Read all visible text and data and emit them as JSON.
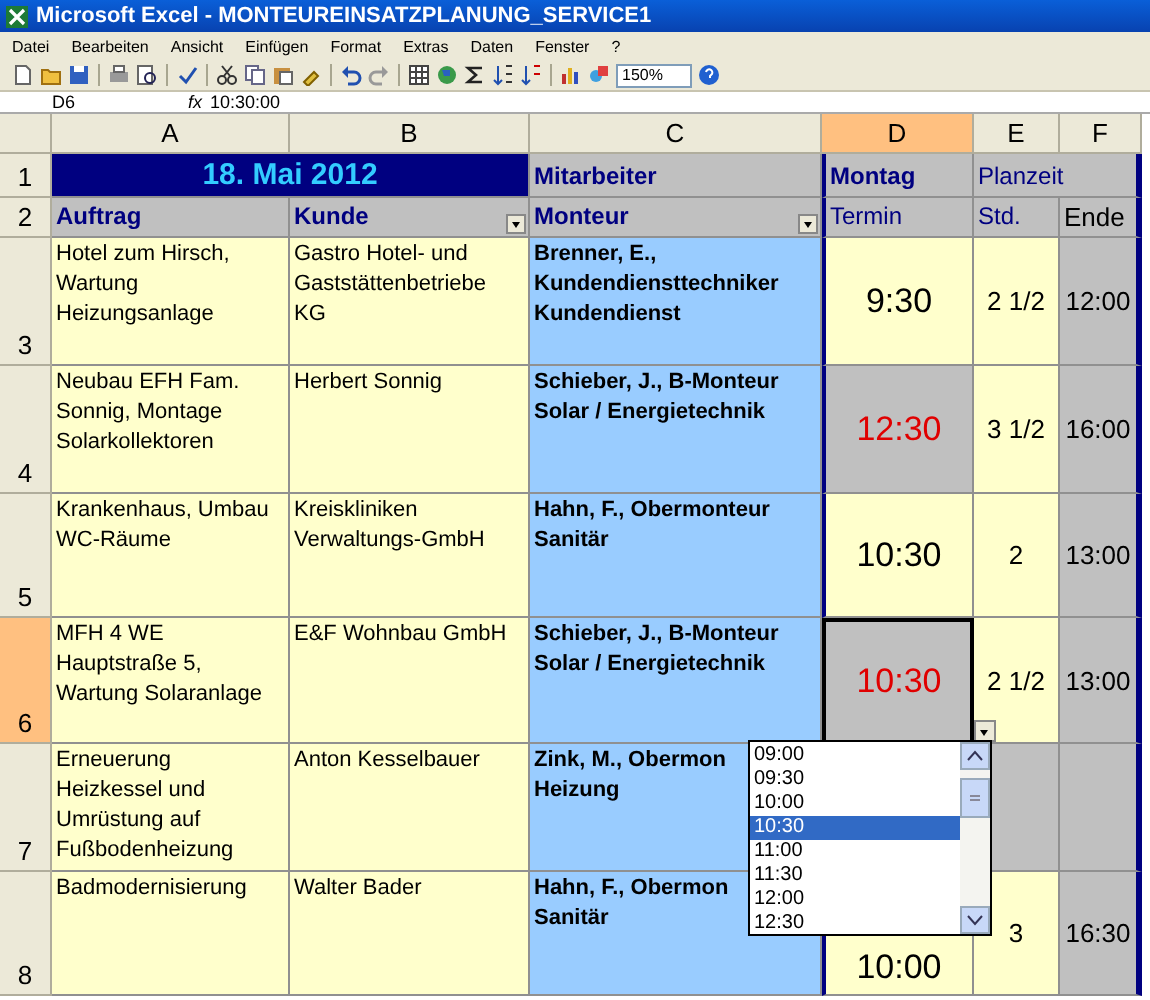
{
  "window": {
    "title": "Microsoft Excel - MONTEUREINSATZPLANUNG_SERVICE1"
  },
  "menu": [
    "Datei",
    "Bearbeiten",
    "Ansicht",
    "Einfügen",
    "Format",
    "Extras",
    "Daten",
    "Fenster",
    "?"
  ],
  "toolbar": {
    "zoom": "150%"
  },
  "formula_bar": {
    "name_box": "D6",
    "fx_label": "fx",
    "formula": "10:30:00"
  },
  "columns": [
    {
      "label": "A",
      "selected": false
    },
    {
      "label": "B",
      "selected": false
    },
    {
      "label": "C",
      "selected": false
    },
    {
      "label": "D",
      "selected": true
    },
    {
      "label": "E",
      "selected": false
    },
    {
      "label": "F",
      "selected": false
    }
  ],
  "title_row": {
    "number": "1",
    "date": "18. Mai 2012",
    "group": "Mitarbeiter",
    "day": "Montag",
    "planned": "Planzeit"
  },
  "heading_row": {
    "number": "2",
    "cells": [
      {
        "text": "Auftrag",
        "filter": false
      },
      {
        "text": "Kunde",
        "filter": true
      },
      {
        "text": "Monteur",
        "filter": true
      },
      {
        "text": "Termin",
        "filter": false
      },
      {
        "text": "Std.",
        "filter": false
      },
      {
        "text": "Ende",
        "filter": false
      }
    ]
  },
  "rows": [
    {
      "number": "3",
      "selected": false,
      "order": "Hotel zum Hirsch,\nWartung\nHeizungsanlage",
      "customer": "Gastro Hotel- und\nGaststättenbetriebe\nKG",
      "fitter": "Brenner, E.,\nKundendiensttechniker\nKundendienst",
      "time": "9:30",
      "conflict": false,
      "blocked": false,
      "hours": "2 1/2",
      "end": "12:00"
    },
    {
      "number": "4",
      "selected": false,
      "order": "Neubau EFH Fam.\nSonnig, Montage\nSolarkollektoren",
      "customer": "Herbert Sonnig",
      "fitter": "Schieber, J., B-Monteur\nSolar / Energietechnik",
      "time": "12:30",
      "conflict": true,
      "blocked": false,
      "hours": "3 1/2",
      "end": "16:00"
    },
    {
      "number": "5",
      "selected": false,
      "order": "Krankenhaus, Umbau\nWC-Räume",
      "customer": "Kreiskliniken\nVerwaltungs-GmbH",
      "fitter": "Hahn, F., Obermonteur\nSanitär",
      "time": "10:30",
      "conflict": false,
      "blocked": false,
      "hours": "2",
      "end": "13:00"
    },
    {
      "number": "6",
      "selected": true,
      "order": "MFH 4 WE\nHauptstraße 5,\nWartung Solaranlage",
      "customer": "E&F Wohnbau GmbH",
      "fitter": "Schieber, J., B-Monteur\nSolar / Energietechnik",
      "time": "10:30",
      "conflict": true,
      "blocked": false,
      "hours": "2 1/2",
      "end": "13:00"
    },
    {
      "number": "7",
      "selected": false,
      "order": "Erneuerung\nHeizkessel und\nUmrüstung auf\nFußbodenheizung",
      "customer": "Anton Kesselbauer",
      "fitter": "Zink, M., Obermon\nHeizung",
      "blocked": true
    },
    {
      "number": "8",
      "selected": false,
      "order": "Badmodernisierung",
      "customer": "Walter Bader",
      "fitter": "Hahn, F., Obermon\nSanitär",
      "time": "10:00",
      "conflict": false,
      "blocked": false,
      "hours": "3",
      "end": "16:30"
    }
  ],
  "dropdown": {
    "items": [
      {
        "text": "09:00",
        "selected": false
      },
      {
        "text": "09:30",
        "selected": false
      },
      {
        "text": "10:00",
        "selected": false
      },
      {
        "text": "10:30",
        "selected": true
      },
      {
        "text": "11:00",
        "selected": false
      },
      {
        "text": "11:30",
        "selected": false
      },
      {
        "text": "12:00",
        "selected": false
      },
      {
        "text": "12:30",
        "selected": false
      }
    ]
  }
}
